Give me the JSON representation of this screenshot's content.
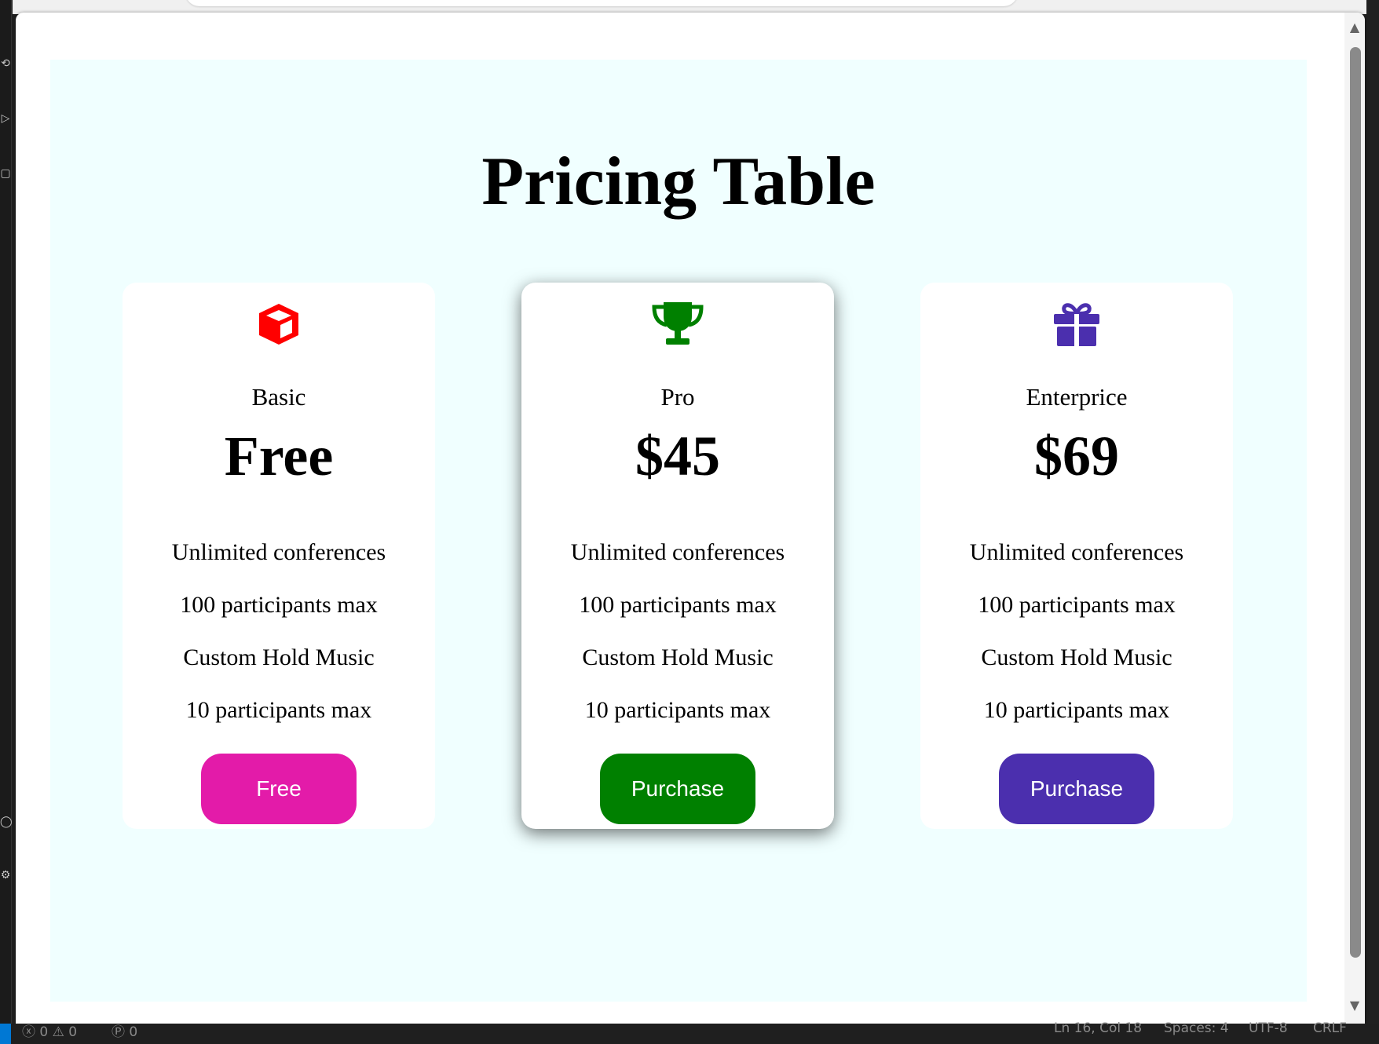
{
  "page": {
    "title": "Pricing Table"
  },
  "plans": [
    {
      "name": "Basic",
      "price": "Free",
      "icon": "cube-icon",
      "accent": "#ff0000",
      "features": [
        "Unlimited conferences",
        "100 participants max",
        "Custom Hold Music",
        "10 participants max"
      ],
      "button_label": "Free",
      "button_color": "#e31ba9",
      "featured": false
    },
    {
      "name": "Pro",
      "price": "$45",
      "icon": "trophy-icon",
      "accent": "#008000",
      "features": [
        "Unlimited conferences",
        "100 participants max",
        "Custom Hold Music",
        "10 participants max"
      ],
      "button_label": "Purchase",
      "button_color": "#008000",
      "featured": true
    },
    {
      "name": "Enterprice",
      "price": "$69",
      "icon": "gift-icon",
      "accent": "#4b2fae",
      "features": [
        "Unlimited conferences",
        "100 participants max",
        "Custom Hold Music",
        "10 participants max"
      ],
      "button_label": "Purchase",
      "button_color": "#4b2fae",
      "featured": false
    }
  ],
  "colors": {
    "page_background": "#f0ffff",
    "card_background": "#ffffff"
  },
  "status_bar": {
    "problems": "ⓧ 0 ⚠ 0",
    "ports": "Ⓟ 0",
    "cursor": "Ln 16, Col 18",
    "spaces": "Spaces: 4",
    "encoding": "UTF-8",
    "eol": "CRLF"
  }
}
